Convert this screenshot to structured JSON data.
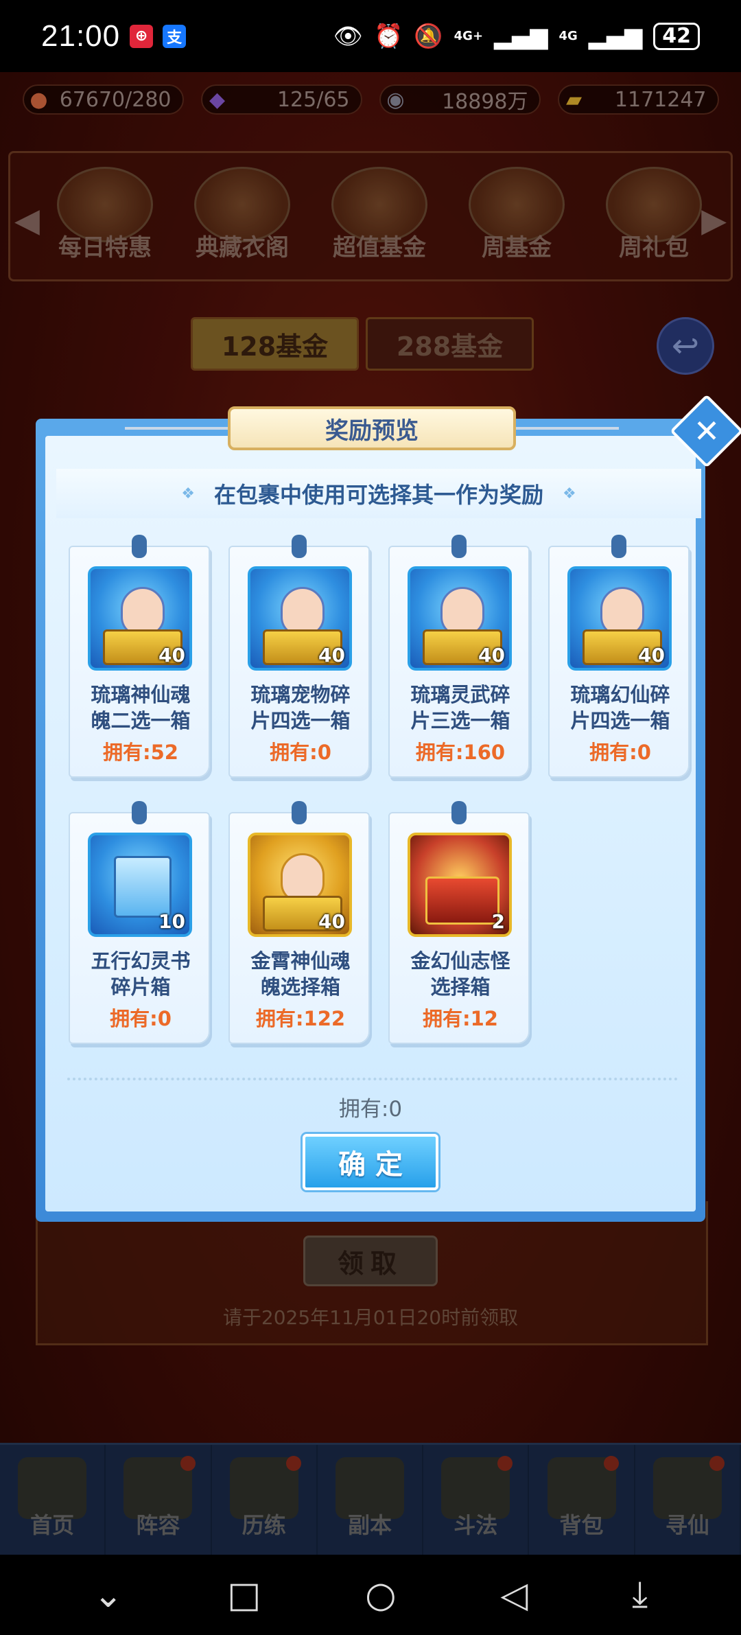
{
  "status_bar": {
    "time": "21:00",
    "apps": [
      {
        "icon": "bank-app-icon",
        "glyph": "⊕"
      },
      {
        "icon": "alipay-app-icon",
        "glyph": "支"
      }
    ],
    "network_1": "4G+",
    "network_2": "4G",
    "battery": "42"
  },
  "resources": [
    {
      "icon": "stamina-peach-icon",
      "glyph": "●",
      "color": "#d86a40",
      "value": "67670/280"
    },
    {
      "icon": "spirit-flame-icon",
      "glyph": "◆",
      "color": "#8a5ad0",
      "value": "125/65"
    },
    {
      "icon": "copper-coin-icon",
      "glyph": "◉",
      "color": "#8a8a9a",
      "value": "18898万"
    },
    {
      "icon": "gold-ingot-icon",
      "glyph": "▰",
      "color": "#e0b030",
      "value": "1171247"
    }
  ],
  "shop_tabs": [
    "每日特惠",
    "典藏衣阁",
    "超值基金",
    "周基金",
    "周礼包"
  ],
  "fund_tabs": {
    "active": "128基金",
    "inactive": "288基金"
  },
  "background": {
    "claim_label": "领取",
    "deadline": "请于2025年11月01日20时前领取"
  },
  "modal": {
    "title": "奖励预览",
    "hint": "在包裹中使用可选择其一作为奖励",
    "items": [
      {
        "name_line1": "琉璃神仙魂",
        "name_line2": "魄二选一箱",
        "qty": "40",
        "owned": "拥有:52",
        "style": "blue"
      },
      {
        "name_line1": "琉璃宠物碎",
        "name_line2": "片四选一箱",
        "qty": "40",
        "owned": "拥有:0",
        "style": "blue"
      },
      {
        "name_line1": "琉璃灵武碎",
        "name_line2": "片三选一箱",
        "qty": "40",
        "owned": "拥有:160",
        "style": "blue"
      },
      {
        "name_line1": "琉璃幻仙碎",
        "name_line2": "片四选一箱",
        "qty": "40",
        "owned": "拥有:0",
        "style": "blue"
      },
      {
        "name_line1": "五行幻灵书",
        "name_line2": "碎片箱",
        "qty": "10",
        "owned": "拥有:0",
        "style": "blue"
      },
      {
        "name_line1": "金霄神仙魂",
        "name_line2": "魄选择箱",
        "qty": "40",
        "owned": "拥有:122",
        "style": "gold"
      },
      {
        "name_line1": "金幻仙志怪",
        "name_line2": "选择箱",
        "qty": "2",
        "owned": "拥有:12",
        "style": "red"
      }
    ],
    "total_owned": "拥有:0",
    "confirm_label": "确定",
    "close_glyph": "✕"
  },
  "bottom_nav": [
    "首页",
    "阵容",
    "历练",
    "副本",
    "斗法",
    "背包",
    "寻仙"
  ],
  "android_nav": [
    {
      "icon": "collapse-chevron-icon",
      "glyph": "⌄"
    },
    {
      "icon": "recents-square-icon",
      "glyph": "□"
    },
    {
      "icon": "home-circle-icon",
      "glyph": "○"
    },
    {
      "icon": "back-triangle-icon",
      "glyph": "◁"
    },
    {
      "icon": "pull-down-icon",
      "glyph": "⤓"
    }
  ]
}
